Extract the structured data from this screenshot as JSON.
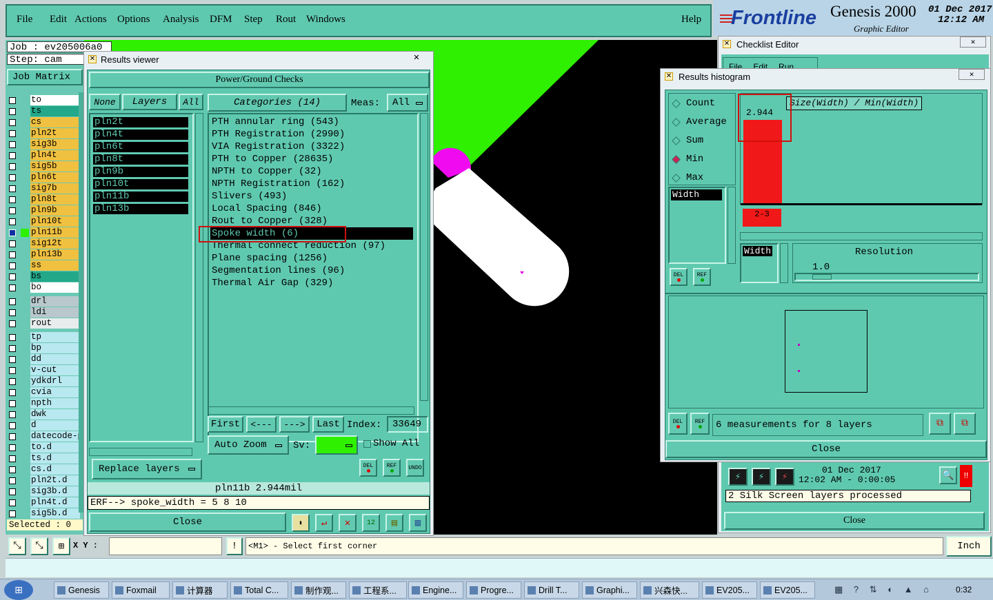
{
  "menubar": {
    "items": [
      "File",
      "Edit",
      "Actions",
      "Options",
      "Analysis",
      "DFM",
      "Step",
      "Rout",
      "Windows"
    ],
    "help": "Help"
  },
  "brand": {
    "logo": "Frontline",
    "product": "Genesis 2000",
    "subtitle": "Graphic Editor",
    "date": "01 Dec 2017",
    "time": "12:12 AM"
  },
  "job": {
    "job_label": "Job : ev205006a0",
    "step_label": "Step: cam",
    "matrix_button": "Job Matrix"
  },
  "layers": {
    "group1": [
      {
        "name": "to",
        "color": "#ffffff"
      },
      {
        "name": "ts",
        "color": "#23a88a"
      },
      {
        "name": "cs",
        "color": "#f0c040"
      },
      {
        "name": "pln2t",
        "color": "#f0c040"
      },
      {
        "name": "sig3b",
        "color": "#f0c040"
      },
      {
        "name": "pln4t",
        "color": "#f0c040"
      },
      {
        "name": "sig5b",
        "color": "#f0c040"
      },
      {
        "name": "pln6t",
        "color": "#f0c040"
      },
      {
        "name": "sig7b",
        "color": "#f0c040"
      },
      {
        "name": "pln8t",
        "color": "#f0c040"
      },
      {
        "name": "pln9b",
        "color": "#f0c040"
      },
      {
        "name": "pln10t",
        "color": "#f0c040"
      },
      {
        "name": "pln11b",
        "color": "#f0c040"
      },
      {
        "name": "sig12t",
        "color": "#f0c040"
      },
      {
        "name": "pln13b",
        "color": "#f0c040"
      },
      {
        "name": "ss",
        "color": "#f0c040"
      },
      {
        "name": "bs",
        "color": "#23a88a"
      },
      {
        "name": "bo",
        "color": "#ffffff"
      }
    ],
    "group2": [
      {
        "name": "drl",
        "color": "#b8c8cc"
      },
      {
        "name": "ldi",
        "color": "#b8c8cc"
      },
      {
        "name": "rout",
        "color": "#e8ecec"
      }
    ],
    "group3": [
      "tp",
      "bp",
      "dd",
      "v-cut",
      "ydkdrl",
      "cvia",
      "npth",
      "dwk",
      "d",
      "datecode-p",
      "to.d",
      "ts.d",
      "cs.d",
      "pln2t.d",
      "sig3b.d",
      "pln4t.d",
      "sig5b.d"
    ],
    "selected_label": "Selected : 0"
  },
  "results_viewer": {
    "title": "Results viewer",
    "header": "Power/Ground Checks",
    "none_btn": "None",
    "layers_btn": "Layers",
    "all_btn": "All",
    "layer_list": [
      "pln2t",
      "pln4t",
      "pln6t",
      "pln8t",
      "pln9b",
      "pln10t",
      "pln11b",
      "pln13b"
    ],
    "categories_btn": "Categories (14)",
    "meas_label": "Meas:",
    "meas_value": "All",
    "categories": [
      "PTH annular ring (543)",
      "PTH Registration (2990)",
      "VIA Registration (3322)",
      "PTH to Copper (28635)",
      "NPTH to Copper (32)",
      "NPTH Registration (162)",
      "Slivers (493)",
      "Local Spacing (846)",
      "Rout to Copper (328)",
      "Spoke width (6)",
      "Thermal connect reduction (97)",
      "Plane spacing (1256)",
      "Segmentation lines (96)",
      "Thermal Air Gap (329)"
    ],
    "selected_category": "Spoke width (6)",
    "nav": {
      "first": "First",
      "prev": "<---",
      "next": "--->",
      "last": "Last",
      "index_label": "Index:",
      "index_value": "33649"
    },
    "auto_zoom": "Auto Zoom",
    "sv_label": "Sv:",
    "show_all": "Show All",
    "replace_layers": "Replace layers",
    "status": "pln11b 2.944mil",
    "erf_line": "ERF--> spoke_width = 5 8 10",
    "close": "Close",
    "icons": {
      "del": "DEL",
      "ref": "REF",
      "undo": "UNDO"
    }
  },
  "checklist": {
    "title": "Checklist Editor",
    "menu": [
      "File",
      "Edit",
      "Run"
    ],
    "date": "01 Dec 2017",
    "time_line": "12:02 AM - 0:00:05",
    "status": "2 Silk Screen layers processed",
    "close": "Close"
  },
  "histogram": {
    "title": "Results histogram",
    "modes": [
      "Count",
      "Average",
      "Sum",
      "Min",
      "Max"
    ],
    "selected_mode": "Min",
    "list_item": "Width",
    "axis_title": "Size(Width) / Min(Width)",
    "bar_value": "2.944",
    "bar_fraction": 1.0,
    "bin_label": "2-3",
    "width_label": "Width",
    "resolution_label": "Resolution",
    "resolution_value": "1.0",
    "measurements": "6 measurements for 8 layers",
    "close": "Close",
    "del": "DEL",
    "ref": "REF"
  },
  "bottom": {
    "xy_label": "X Y :",
    "prompt": "<M1> - Select first corner",
    "units": "Inch"
  },
  "taskbar": {
    "items": [
      "Genesis",
      "Foxmail",
      "计算器",
      "Total C...",
      "制作观...",
      "工程系...",
      "Engine...",
      "Progre...",
      "Drill T...",
      "Graphi...",
      "兴森快...",
      "EV205...",
      "EV205..."
    ],
    "clock": "0:32"
  }
}
